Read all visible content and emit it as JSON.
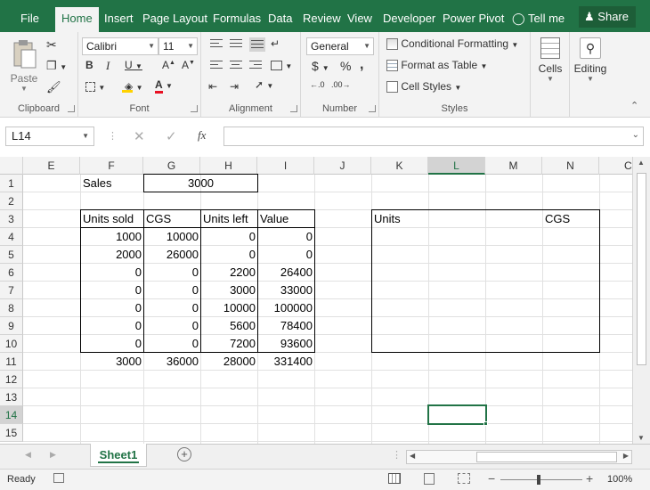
{
  "ribbon_tabs": [
    "File",
    "Home",
    "Insert",
    "Page Layout",
    "Formulas",
    "Data",
    "Review",
    "View",
    "Developer",
    "Power Pivot",
    "Tell me"
  ],
  "active_tab": "Home",
  "share_label": "Share",
  "clipboard": {
    "paste_label": "Paste",
    "group_label": "Clipboard"
  },
  "font": {
    "name": "Calibri",
    "size": "11",
    "group_label": "Font",
    "font_color": "#e81123"
  },
  "alignment": {
    "group_label": "Alignment"
  },
  "number": {
    "format": "General",
    "currency": "$",
    "percent": "%",
    "comma": ",",
    "group_label": "Number"
  },
  "styles": {
    "conditional": "Conditional Formatting",
    "table": "Format as Table",
    "cell_styles": "Cell Styles",
    "group_label": "Styles"
  },
  "cells": {
    "label": "Cells"
  },
  "editing": {
    "label": "Editing"
  },
  "formula_bar": {
    "name_box": "L14",
    "fx": "fx",
    "formula": ""
  },
  "columns": [
    "E",
    "F",
    "G",
    "H",
    "I",
    "J",
    "K",
    "L",
    "M",
    "N",
    "C"
  ],
  "rows": [
    "1",
    "2",
    "3",
    "4",
    "5",
    "6",
    "7",
    "8",
    "9",
    "10",
    "11",
    "12",
    "13",
    "14",
    "15"
  ],
  "selected_column": "L",
  "selected_row": "14",
  "sheet": {
    "sales_label": "Sales",
    "sales_value": "3000",
    "headers": [
      "Units sold",
      "CGS",
      "Units left",
      "Value"
    ],
    "data_rows": [
      [
        "1000",
        "10000",
        "0",
        "0"
      ],
      [
        "2000",
        "26000",
        "0",
        "0"
      ],
      [
        "0",
        "0",
        "2200",
        "26400"
      ],
      [
        "0",
        "0",
        "3000",
        "33000"
      ],
      [
        "0",
        "0",
        "10000",
        "100000"
      ],
      [
        "0",
        "0",
        "5600",
        "78400"
      ],
      [
        "0",
        "0",
        "7200",
        "93600"
      ]
    ],
    "totals": [
      "3000",
      "36000",
      "28000",
      "331400"
    ],
    "side_units": "Units",
    "side_cgs": "CGS"
  },
  "sheet_tabs": [
    "Sheet1"
  ],
  "status": {
    "ready": "Ready",
    "zoom": "100%"
  },
  "accent": "#217346"
}
